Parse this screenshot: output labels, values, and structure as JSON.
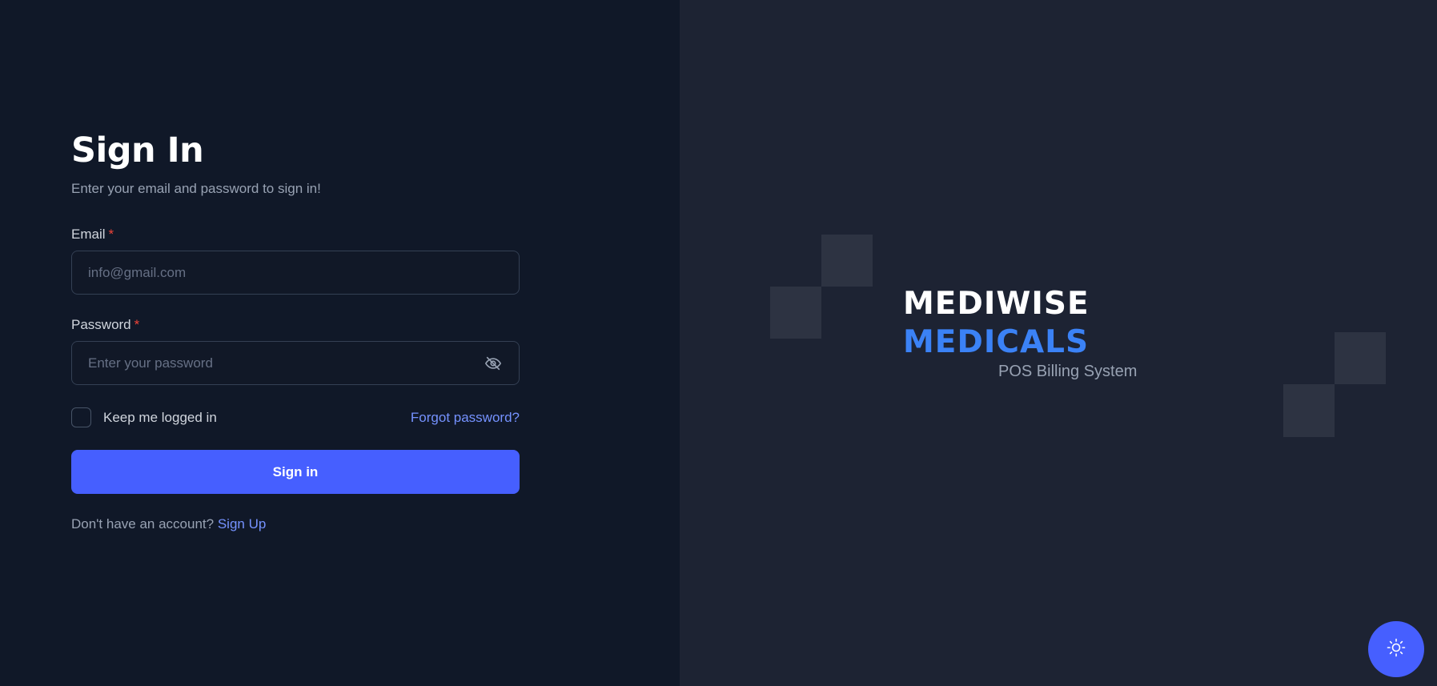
{
  "signin": {
    "title": "Sign In",
    "subtitle": "Enter your email and password to sign in!",
    "email": {
      "label": "Email",
      "required_mark": "*",
      "placeholder": "info@gmail.com",
      "value": ""
    },
    "password": {
      "label": "Password",
      "required_mark": "*",
      "placeholder": "Enter your password",
      "value": ""
    },
    "keep_logged_in": {
      "label": "Keep me logged in",
      "checked": false
    },
    "forgot_password": "Forgot password?",
    "submit_label": "Sign in",
    "signup_prompt": "Don't have an account?",
    "signup_link": "Sign Up"
  },
  "brand": {
    "line1": "MEDIWISE",
    "line2": "MEDICALS",
    "tagline": "POS Billing System"
  },
  "icons": {
    "password_toggle": "eye-off-icon",
    "theme_toggle": "sun-icon"
  },
  "colors": {
    "left_bg": "#101828",
    "right_bg": "#1d2333",
    "accent": "#465fff",
    "link": "#7592ff",
    "brand_blue": "#3b82f6",
    "required": "#f04438"
  }
}
